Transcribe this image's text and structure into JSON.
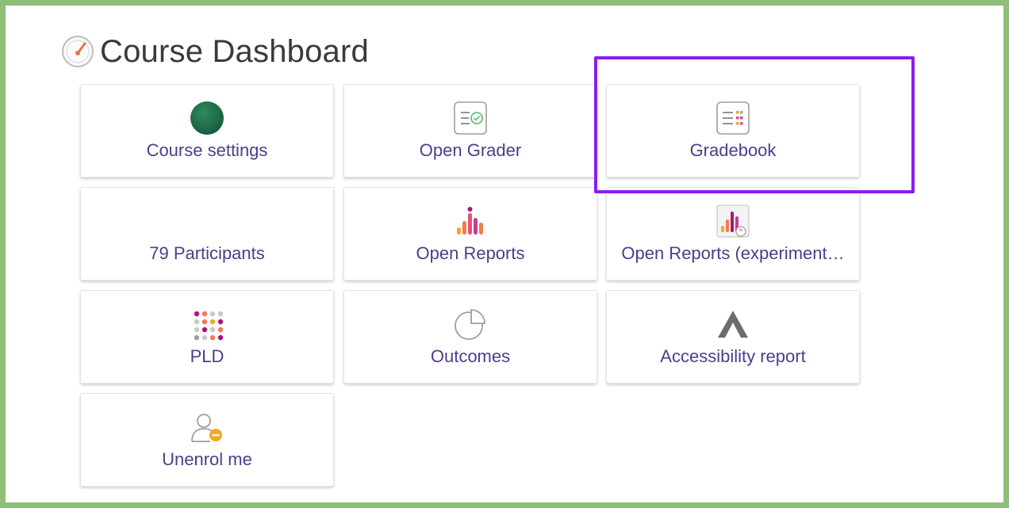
{
  "page": {
    "title": "Course Dashboard"
  },
  "tiles": [
    {
      "label": "Course settings",
      "icon": "course-settings-icon"
    },
    {
      "label": "Open Grader",
      "icon": "open-grader-icon"
    },
    {
      "label": "Gradebook",
      "icon": "gradebook-icon"
    },
    {
      "label": "79 Participants",
      "icon": ""
    },
    {
      "label": "Open Reports",
      "icon": "reports-icon"
    },
    {
      "label": "Open Reports (experiment…",
      "icon": "reports-experimental-icon"
    },
    {
      "label": "PLD",
      "icon": "pld-icon"
    },
    {
      "label": "Outcomes",
      "icon": "outcomes-icon"
    },
    {
      "label": "Accessibility report",
      "icon": "accessibility-icon"
    },
    {
      "label": "Unenrol me",
      "icon": "unenrol-icon"
    }
  ],
  "colors": {
    "frame": "#8dbf78",
    "highlight": "#8a1cf0",
    "tile_label": "#4f3c8a"
  }
}
